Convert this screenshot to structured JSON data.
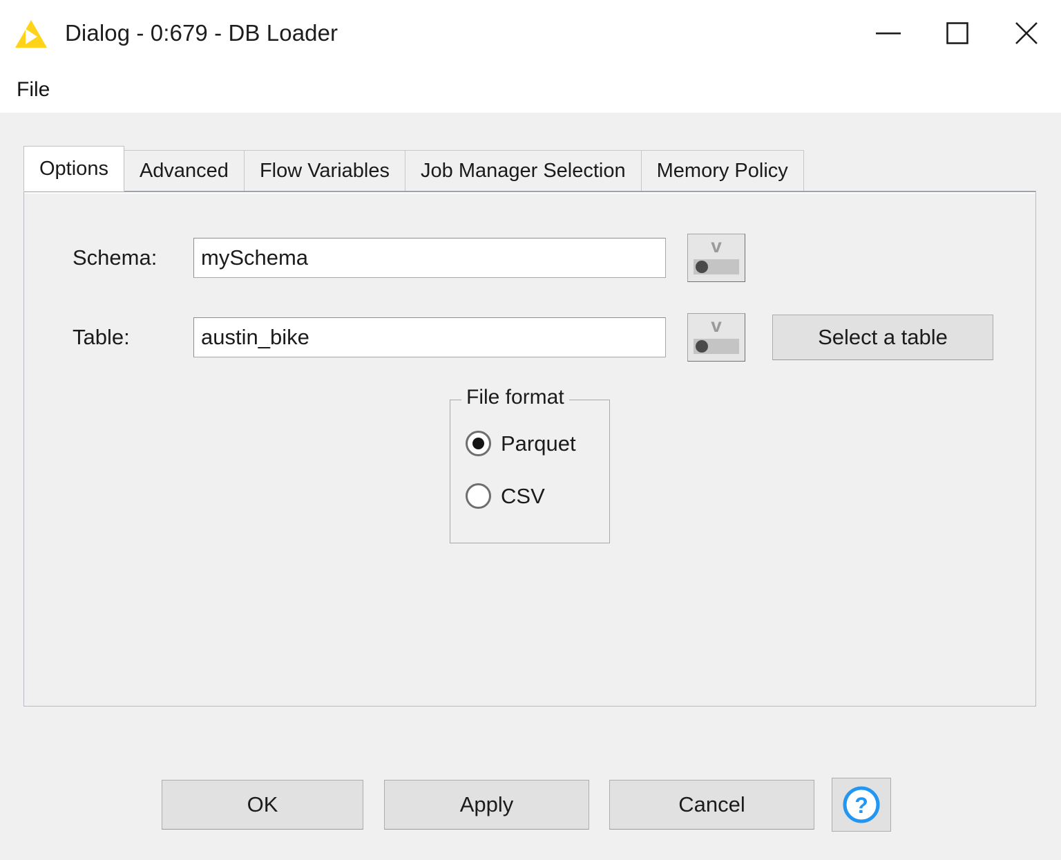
{
  "window": {
    "title": "Dialog - 0:679 - DB Loader",
    "app_icon": "knime-triangle-icon",
    "controls": {
      "minimize": "minimize-icon",
      "maximize": "maximize-icon",
      "close": "close-icon"
    }
  },
  "menubar": {
    "items": [
      {
        "label": "File"
      }
    ]
  },
  "tabs": [
    {
      "label": "Options",
      "active": true
    },
    {
      "label": "Advanced",
      "active": false
    },
    {
      "label": "Flow Variables",
      "active": false
    },
    {
      "label": "Job Manager Selection",
      "active": false
    },
    {
      "label": "Memory Policy",
      "active": false
    }
  ],
  "options": {
    "schema": {
      "label": "Schema:",
      "value": "mySchema",
      "placeholder": "",
      "flow_variable_icon": "flow-variable-icon"
    },
    "table": {
      "label": "Table:",
      "value": "austin_bike",
      "placeholder": "",
      "flow_variable_icon": "flow-variable-icon",
      "select_button": "Select a table"
    },
    "file_format": {
      "legend": "File format",
      "selected": "Parquet",
      "choices": [
        {
          "label": "Parquet",
          "checked": true
        },
        {
          "label": "CSV",
          "checked": false
        }
      ]
    }
  },
  "footer": {
    "ok": "OK",
    "apply": "Apply",
    "cancel": "Cancel",
    "help_icon": "help-question-icon"
  },
  "colors": {
    "window_background": "#f0f0f0",
    "titlebar_background": "#ffffff",
    "brand_yellow": "#ffd31a",
    "help_blue": "#2196f3",
    "text": "#1b1b1b"
  }
}
